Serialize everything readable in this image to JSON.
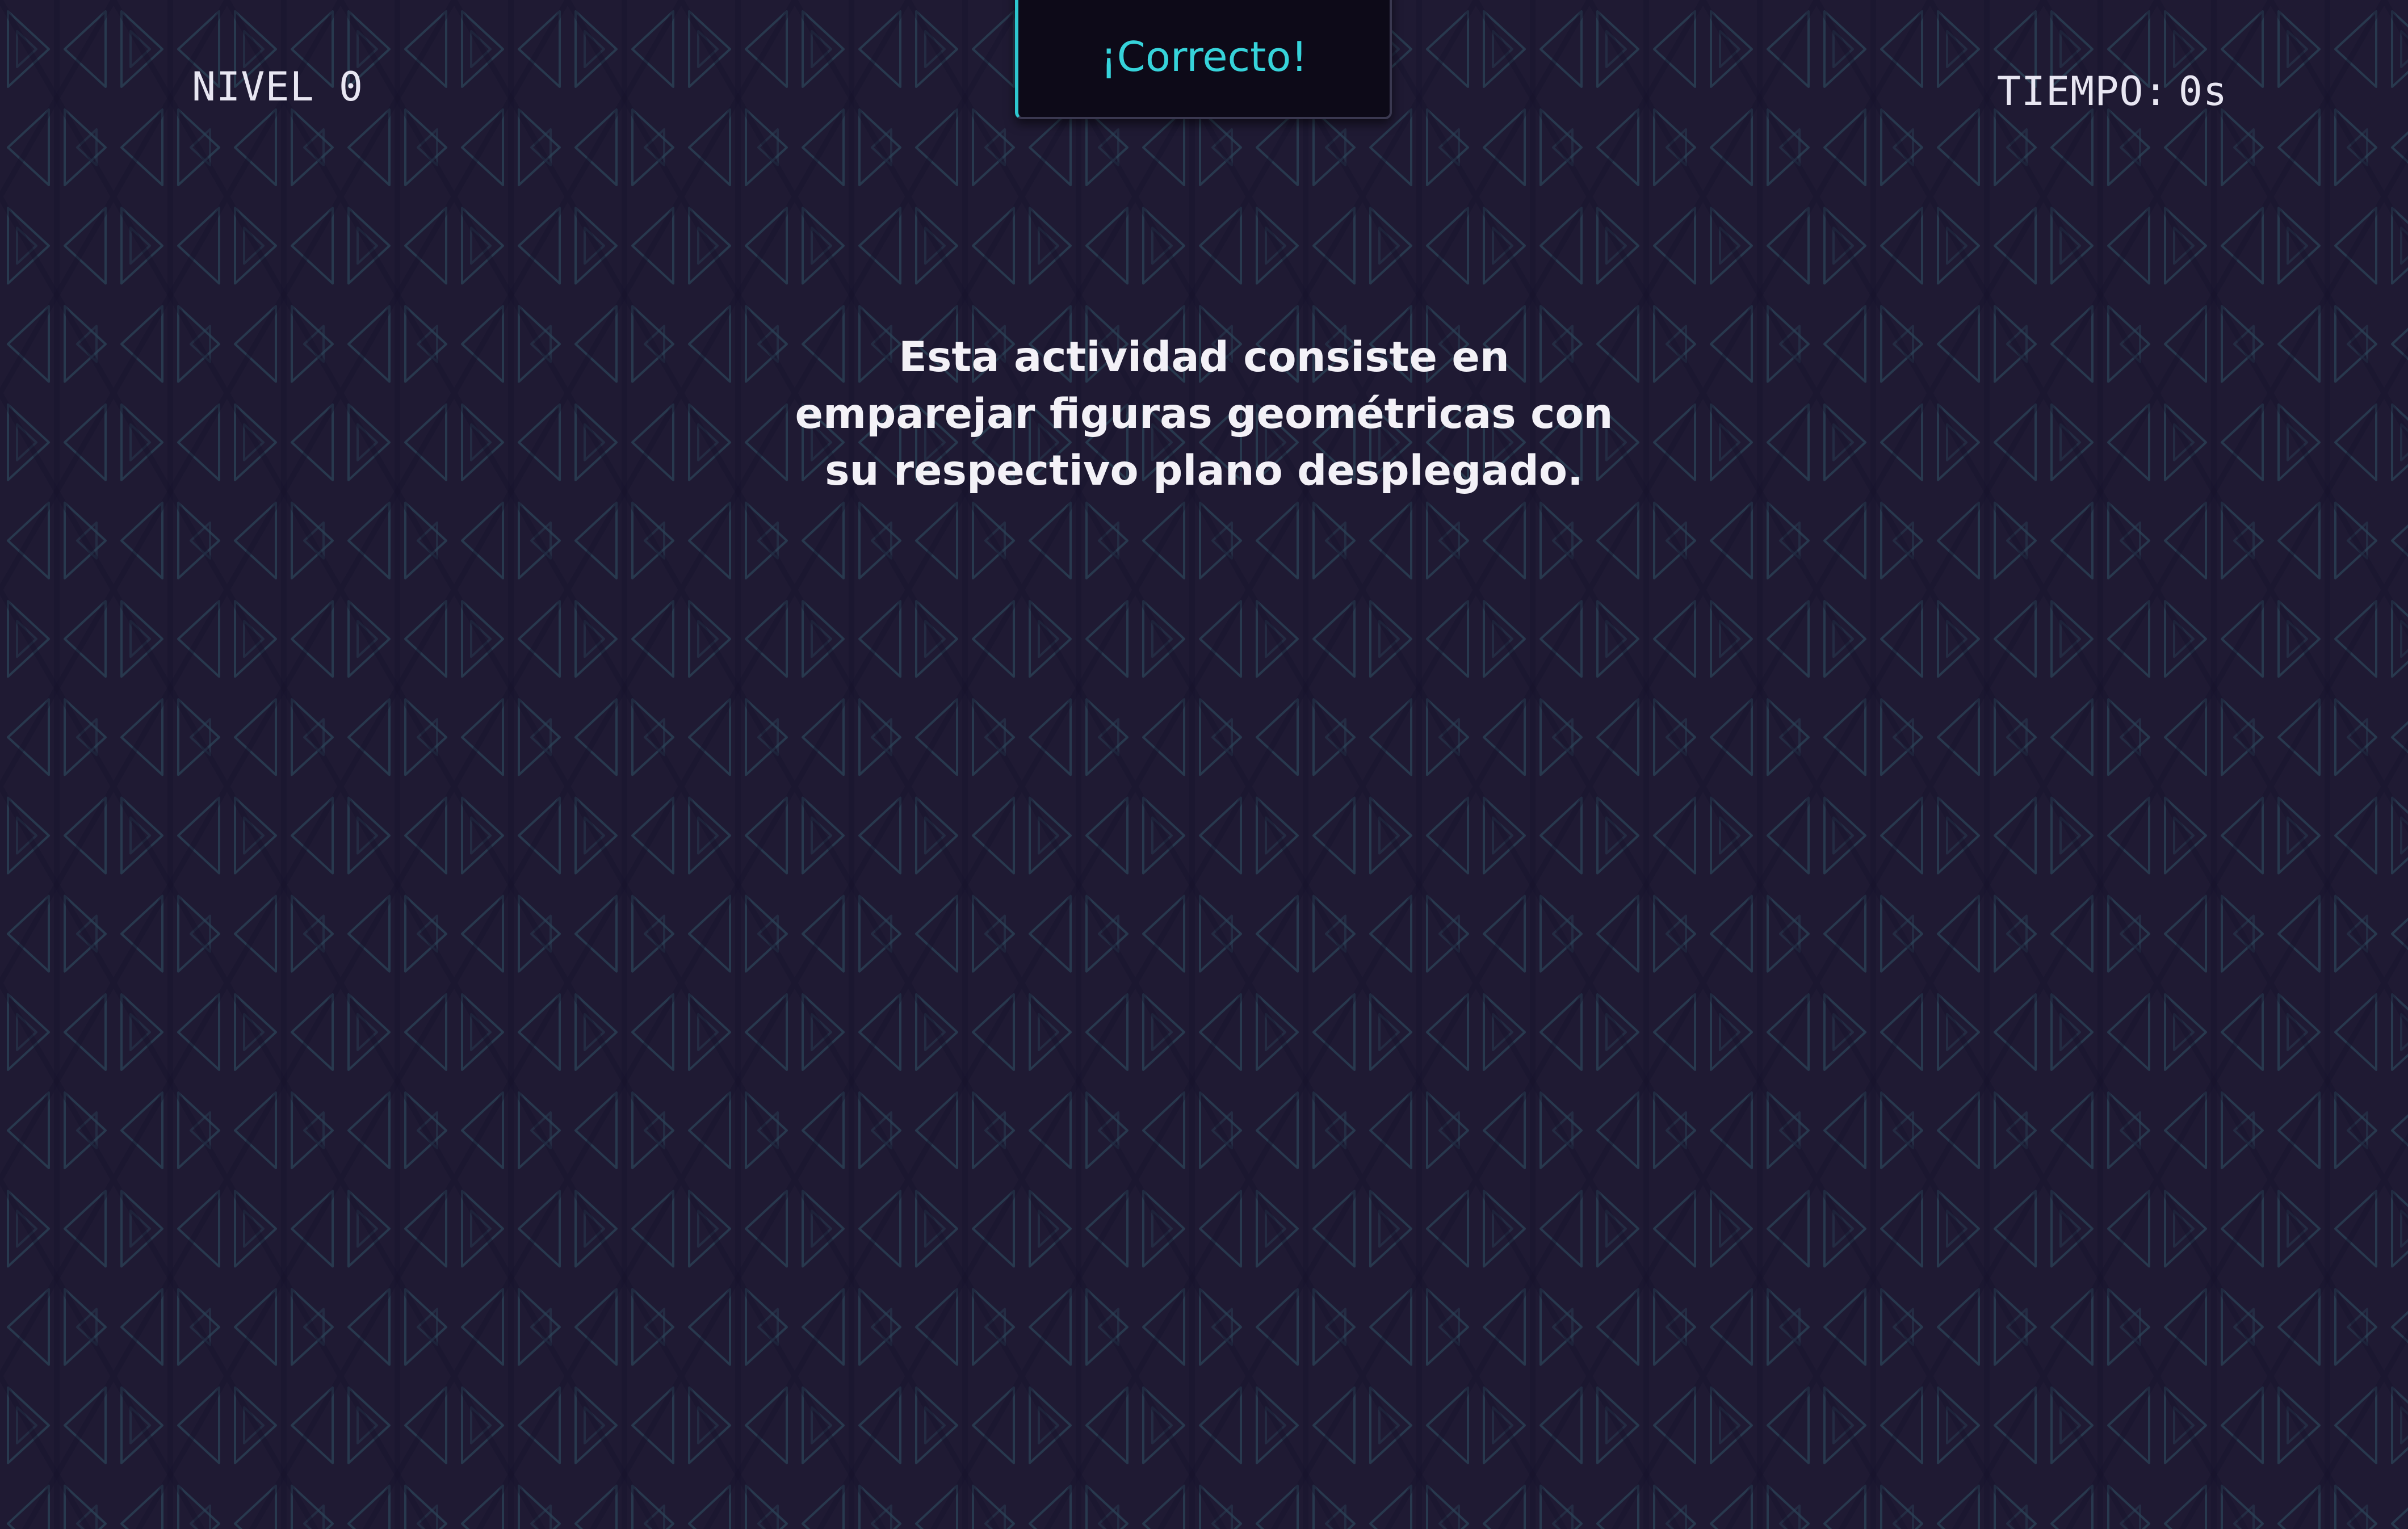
{
  "hud": {
    "level_label": "NIVEL 0",
    "time_label": "TIEMPO:",
    "time_value": "0s"
  },
  "toast": {
    "message": "¡Correcto!"
  },
  "intro": {
    "lines": [
      "Esta actividad consiste en",
      "emparejar figuras geométricas con",
      "su respectivo plano desplegado."
    ]
  },
  "colors": {
    "background": "#1f1a33",
    "pattern_stroke": "#2a4256",
    "toast_accent": "#36d3da",
    "text": "#f3f1f7"
  },
  "icons": {
    "background_pattern": "triangle-pattern-icon"
  }
}
